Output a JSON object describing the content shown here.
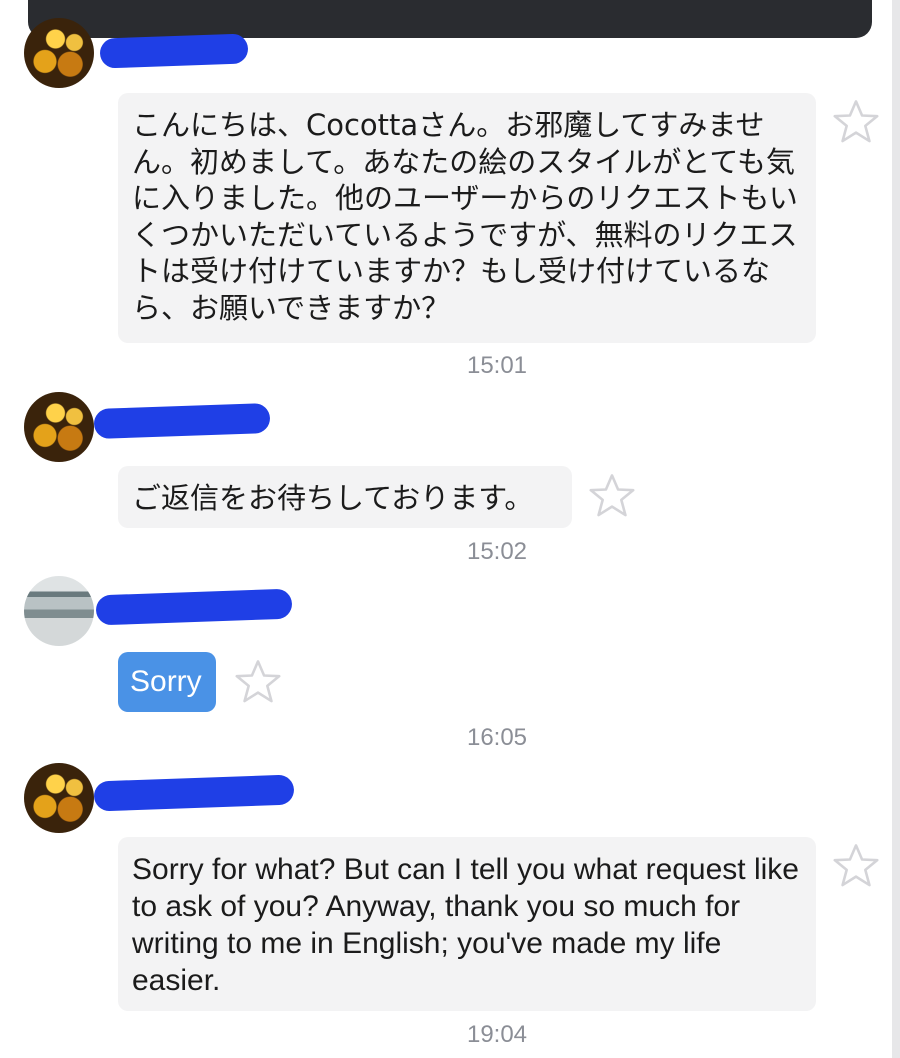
{
  "messages": [
    {
      "text": "こんにちは、Cocottaさん。お邪魔してすみません。初めまして。あなたの絵のスタイルがとても気に入りました。他のユーザーからのリクエストもいくつかいただいているようですが、無料のリクエストは受け付けていますか？もし受け付けているなら、お願いできますか？",
      "time": "15:01",
      "star_icon": "star-outline-icon"
    },
    {
      "text": "ご返信をお待ちしております。",
      "time": "15:02",
      "star_icon": "star-outline-icon"
    },
    {
      "text": "Sorry",
      "time": "16:05",
      "star_icon": "star-outline-icon"
    },
    {
      "text": "Sorry for what? But can I tell you what request like to ask of you? Anyway, thank you so much for writing to me in English; you've made my life easier.",
      "time": "19:04",
      "star_icon": "star-outline-icon"
    }
  ],
  "colors": {
    "reply_bubble": "#4a92e6",
    "message_bubble": "#f3f3f4",
    "timestamp": "#8b8e96",
    "redaction": "#1f3fe6"
  }
}
